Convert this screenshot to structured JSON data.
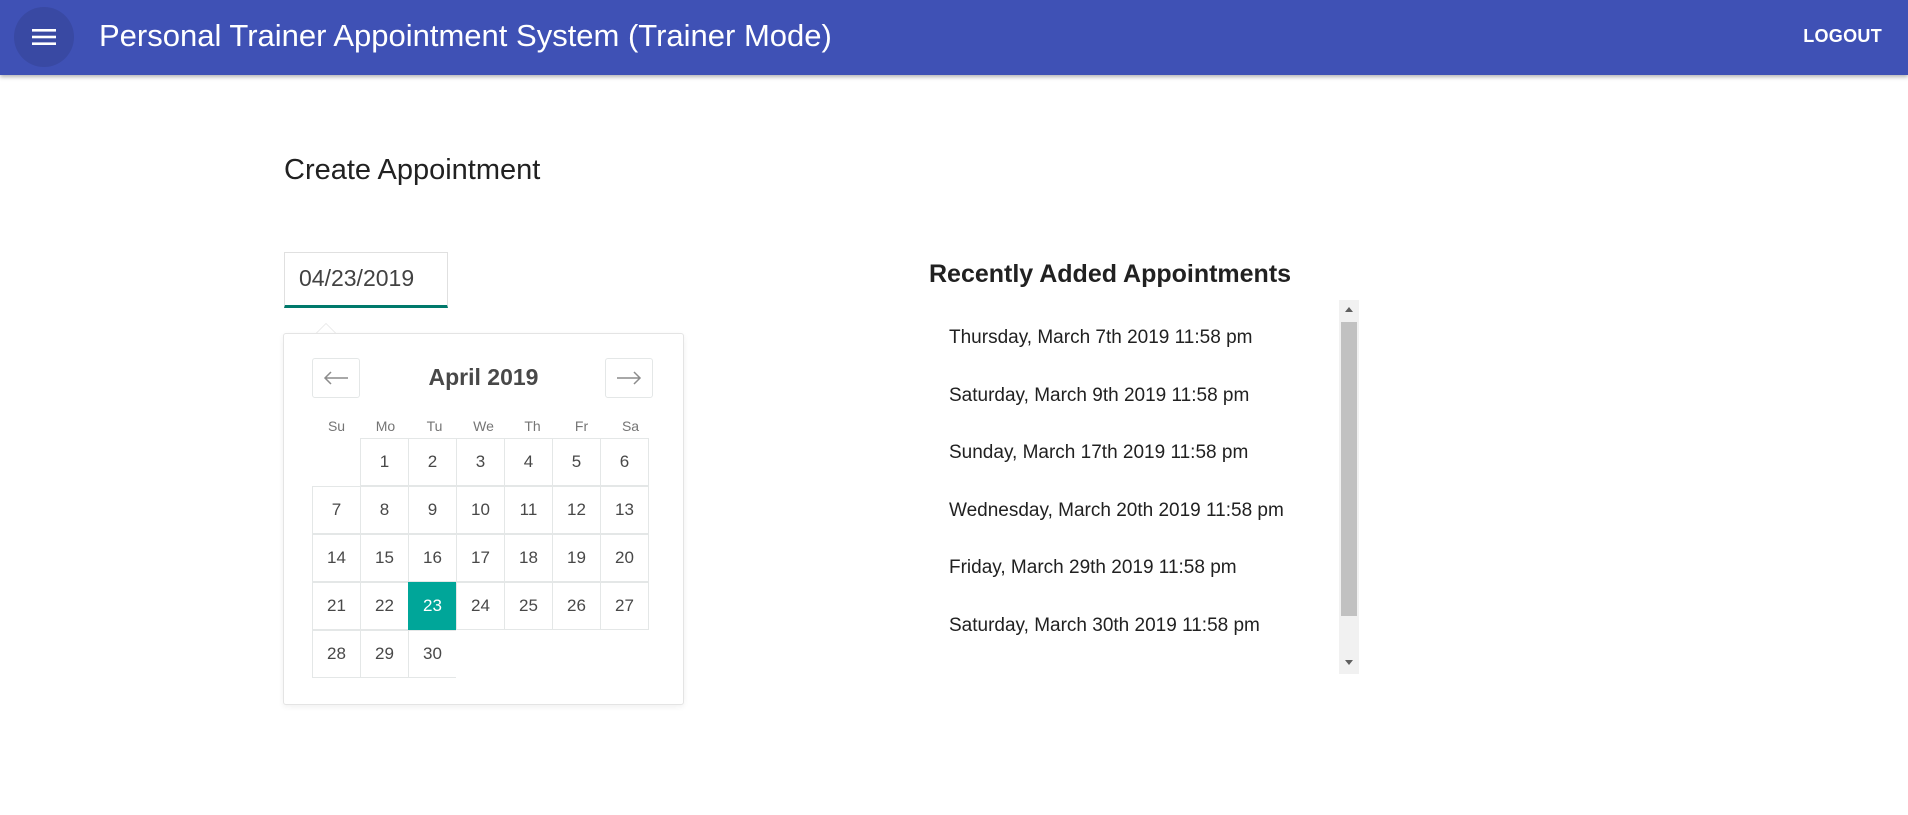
{
  "header": {
    "title": "Personal Trainer Appointment System (Trainer Mode)",
    "logout_label": "LOGOUT",
    "menu_icon": "menu-icon",
    "color": "#3f51b5"
  },
  "main": {
    "heading": "Create Appointment",
    "date_input": {
      "value": "04/23/2019"
    },
    "calendar": {
      "month_label": "April 2019",
      "prev_icon": "arrow-left-icon",
      "next_icon": "arrow-right-icon",
      "weekdays": [
        "Su",
        "Mo",
        "Tu",
        "We",
        "Th",
        "Fr",
        "Sa"
      ],
      "weeks": [
        [
          "",
          "1",
          "2",
          "3",
          "4",
          "5",
          "6"
        ],
        [
          "7",
          "8",
          "9",
          "10",
          "11",
          "12",
          "13"
        ],
        [
          "14",
          "15",
          "16",
          "17",
          "18",
          "19",
          "20"
        ],
        [
          "21",
          "22",
          "23",
          "24",
          "25",
          "26",
          "27"
        ],
        [
          "28",
          "29",
          "30",
          "",
          "",
          "",
          ""
        ]
      ],
      "selected_day": "23",
      "selected_color": "#00a699"
    }
  },
  "recent": {
    "title": "Recently Added Appointments",
    "items": [
      "Thursday, March 7th 2019 11:58 pm",
      "Saturday, March 9th 2019 11:58 pm",
      "Sunday, March 17th 2019 11:58 pm",
      "Wednesday, March 20th 2019 11:58 pm",
      "Friday, March 29th 2019 11:58 pm",
      "Saturday, March 30th 2019 11:58 pm"
    ]
  }
}
